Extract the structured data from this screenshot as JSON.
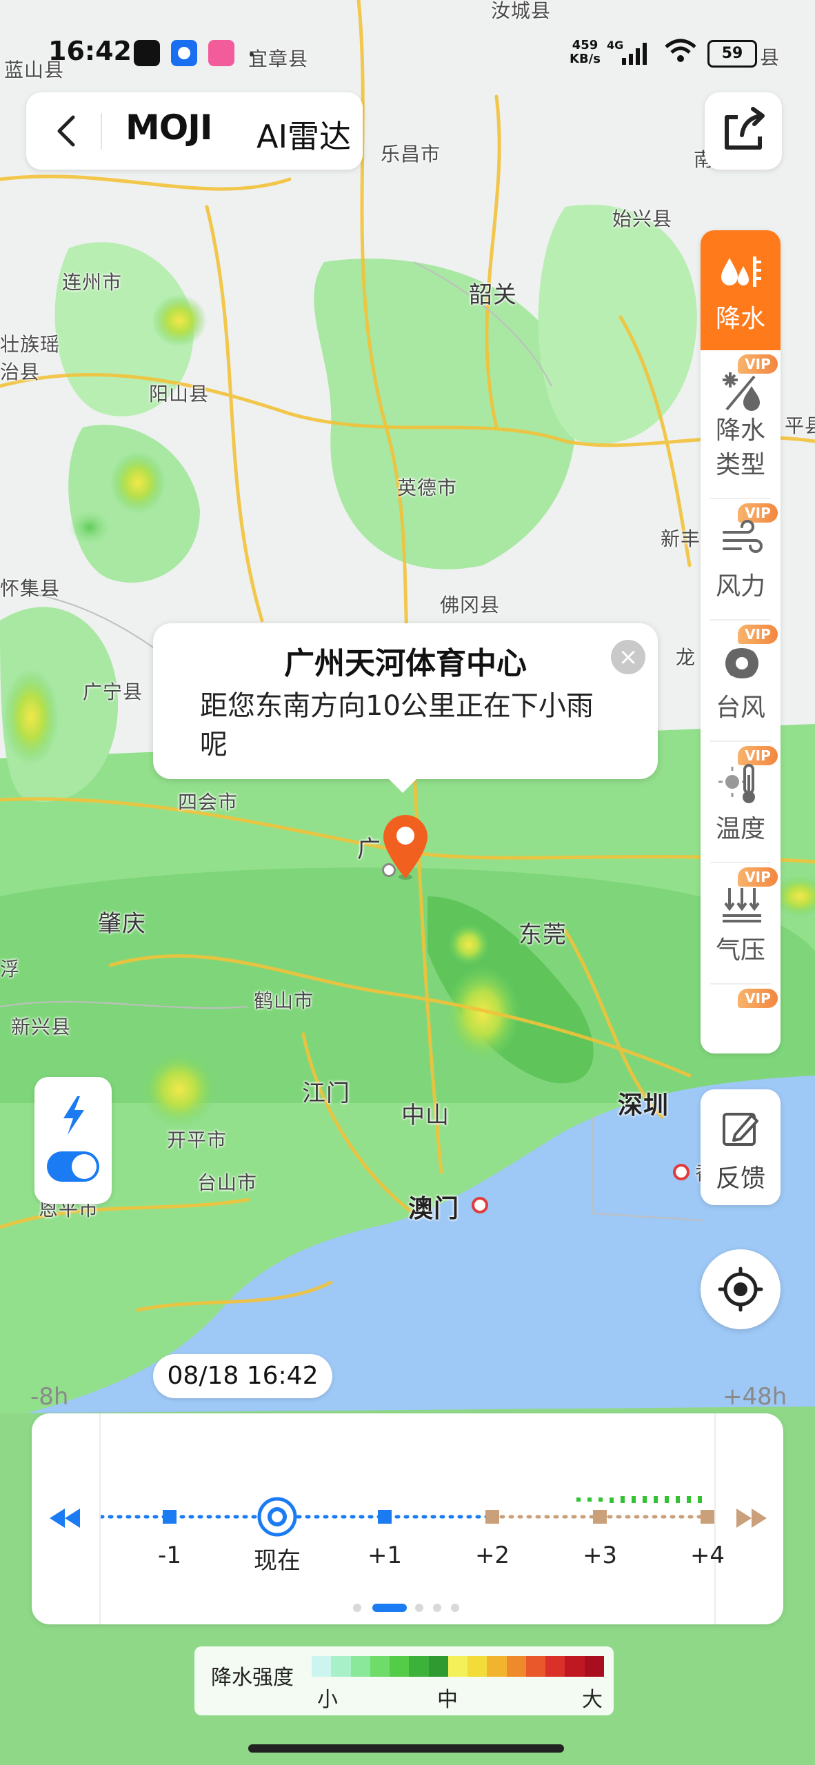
{
  "status_bar": {
    "time": "16:42",
    "net_speed": "459\nKB/s",
    "net_type": "4G",
    "battery": "59"
  },
  "header": {
    "brand": "MOJI",
    "title": "AI雷达"
  },
  "map_labels": {
    "l1": "汝城县",
    "l2": "蓝山县",
    "l3": "宜章县",
    "l4": "乐昌市",
    "l5": "始兴县",
    "l6": "连州市",
    "l7": "韶关",
    "l8": "壮族瑶",
    "l9": "治县",
    "l10": "阳山县",
    "l11": "英德市",
    "l12": "新丰",
    "l13": "怀集县",
    "l14": "佛冈县",
    "l15": "广宁县",
    "l16": "龙",
    "l17": "四会市",
    "l18": "广",
    "l19": "肇庆",
    "l20": "东莞",
    "l21": "鹤山市",
    "l22": "新兴县",
    "l23": "江门",
    "l24": "中山",
    "l25": "深圳",
    "l26": "开平市",
    "l27": "台山市",
    "l28": "澳门",
    "l29": "恩平市",
    "l30": "香",
    "l31": "县",
    "l32": "平县",
    "l33": "浮",
    "l34": "南"
  },
  "layers": {
    "precip": "降水",
    "precip_type_1": "降水",
    "precip_type_2": "类型",
    "wind": "风力",
    "typhoon": "台风",
    "temperature": "温度",
    "pressure": "气压",
    "vip": "VIP"
  },
  "feedback": {
    "label": "反馈"
  },
  "popup": {
    "title": "广州天河体育中心",
    "description": "距您东南方向10公里正在下小雨呢",
    "close": "×"
  },
  "timeline": {
    "current_time": "08/18 16:42",
    "left_edge": "-8h",
    "right_edge": "+48h",
    "ticks": [
      "-1",
      "现在",
      "+1",
      "+2",
      "+3",
      "+4"
    ]
  },
  "legend": {
    "title": "降水强度",
    "low": "小",
    "mid": "中",
    "high": "大",
    "colors": [
      "#cdf5f0",
      "#a8f0c8",
      "#8ae89a",
      "#6fdc6a",
      "#55cc48",
      "#3db23a",
      "#2f9a30",
      "#f4f05a",
      "#f2dc3a",
      "#f2b42e",
      "#ef8a2c",
      "#e9582a",
      "#d9302a",
      "#c01822",
      "#a80e1e"
    ]
  },
  "colors": {
    "accent_orange": "#ff7a1a",
    "toggle_blue": "#1a7bf2",
    "timeline_blue": "#1a7bf2",
    "timeline_brown": "#c9a07a",
    "future_green": "#33c233"
  }
}
